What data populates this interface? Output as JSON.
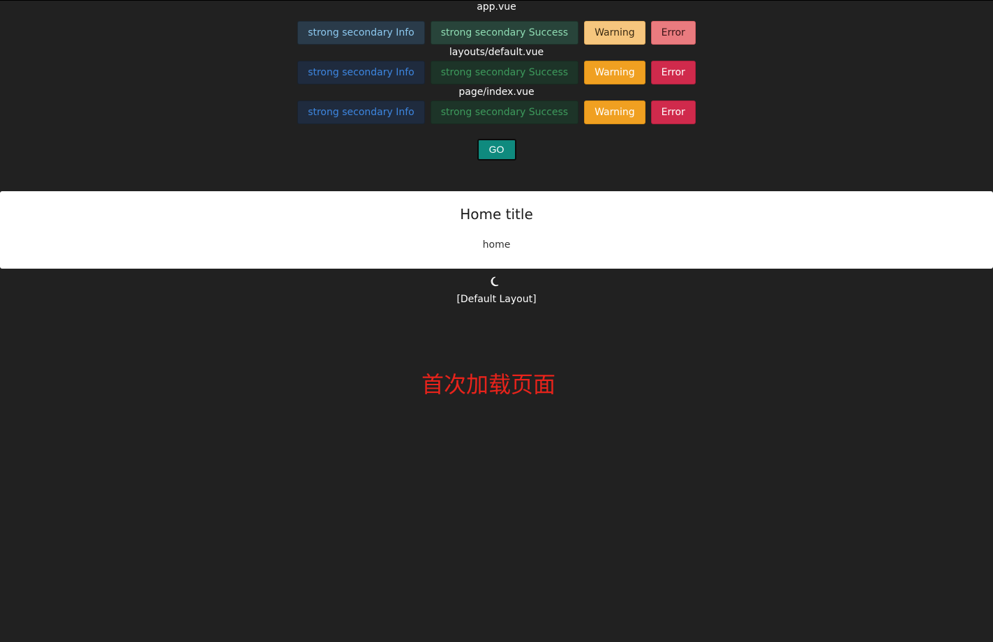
{
  "sections": [
    {
      "title": "app.vue",
      "buttons": [
        {
          "label": "strong secondary Info"
        },
        {
          "label": "strong secondary Success"
        },
        {
          "label": "Warning"
        },
        {
          "label": "Error"
        }
      ]
    },
    {
      "title": "layouts/default.vue",
      "buttons": [
        {
          "label": "strong secondary Info"
        },
        {
          "label": "strong secondary Success"
        },
        {
          "label": "Warning"
        },
        {
          "label": "Error"
        }
      ]
    },
    {
      "title": "page/index.vue",
      "buttons": [
        {
          "label": "strong secondary Info"
        },
        {
          "label": "strong secondary Success"
        },
        {
          "label": "Warning"
        },
        {
          "label": "Error"
        }
      ]
    }
  ],
  "go_button": {
    "label": "GO"
  },
  "card": {
    "title": "Home title",
    "text": "home"
  },
  "theme_toggle": {
    "icon": "moon-icon"
  },
  "layout_label": "[Default Layout]",
  "loading_message": "首次加载页面",
  "colors": {
    "background": "#212121",
    "go_button": "#0f8a7e",
    "loading_message": "#e8231b",
    "warning": "#f0a021",
    "error": "#d02a4c",
    "info_text": "#3d86e0",
    "success_text": "#3d9a5c"
  }
}
